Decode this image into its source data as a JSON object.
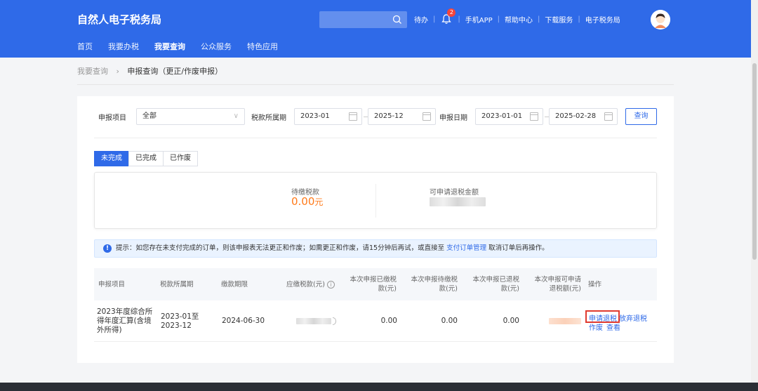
{
  "header": {
    "title": "自然人电子税务局",
    "search_placeholder": "",
    "todo": "待办",
    "notification_count": "2",
    "links": [
      "手机APP",
      "帮助中心",
      "下载服务",
      "电子税务局"
    ]
  },
  "nav": [
    "首页",
    "我要办税",
    "我要查询",
    "公众服务",
    "特色应用"
  ],
  "breadcrumb": {
    "parent": "我要查询",
    "arrow": "›",
    "current": "申报查询（更正/作废申报）"
  },
  "filters": {
    "item_label": "申报项目",
    "item_value": "全部",
    "period_label": "税款所属期",
    "period_start": "2023-01",
    "period_end": "2025-12",
    "date_label": "申报日期",
    "date_start": "2023-01-01",
    "date_end": "2025-02-28",
    "query_button": "查询"
  },
  "tabs": [
    "未完成",
    "已完成",
    "已作废"
  ],
  "summary": {
    "pending_label": "待缴税款",
    "pending_value": "0.00",
    "pending_unit": "元",
    "refund_label": "可申请退税金额"
  },
  "notice": {
    "text_before": "提示：如您存在未支付完成的订单，则该申报表无法更正和作废；如需更正和作废，请15分钟后再试，或直接至",
    "link": "支付订单管理",
    "text_after": "取消订单后再操作。"
  },
  "table": {
    "headers": [
      "申报项目",
      "税款所属期",
      "缴款期限",
      "应缴税款(元)",
      "本次申报已缴税款(元)",
      "本次申报待缴税款(元)",
      "本次申报已退税款(元)",
      "本次申报可申请退税额(元)",
      "操作"
    ],
    "row": {
      "item": "2023年度综合所得年度汇算(含境外所得)",
      "period": "2023-01至2023-12",
      "deadline": "2024-06-30",
      "paid": "0.00",
      "pending": "0.00",
      "refunded": "0.00",
      "actions": [
        "申请退税",
        "放弃退税",
        "作废",
        "查看"
      ]
    }
  },
  "colors": {
    "primary": "#2f6ae8",
    "amount": "#ff7a1a",
    "highlight": "#e03a2f"
  }
}
